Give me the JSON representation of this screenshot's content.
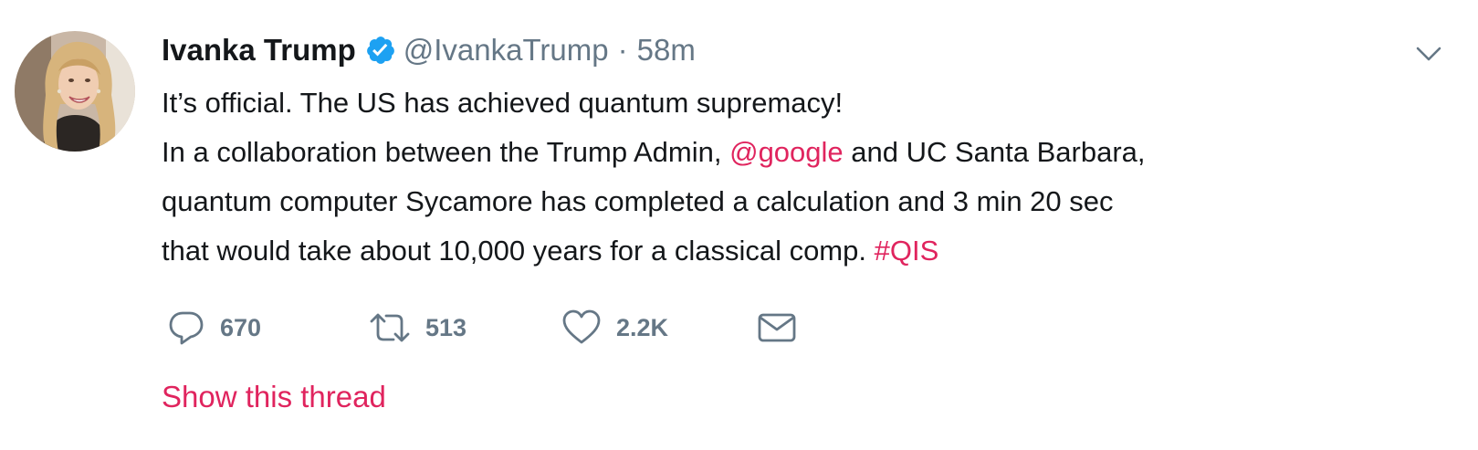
{
  "tweet": {
    "author": {
      "name": "Ivanka Trump",
      "handle": "@IvankaTrump",
      "separator": "·",
      "time": "58m",
      "verified_icon": "verified-badge-icon",
      "avatar": "profile-photo"
    },
    "text": {
      "line1": "It’s official. The US has achieved quantum supremacy!",
      "line2_pre": "In a collaboration between the Trump Admin, ",
      "line2_mention": "@google",
      "line2_post": " and UC Santa Barbara,",
      "line3": "quantum computer Sycamore  has completed a calculation and 3 min 20 sec",
      "line4_pre": "that would take about 10,000 years for a classical comp. ",
      "line4_hashtag": "#QIS"
    },
    "actions": {
      "reply_count": "670",
      "retweet_count": "513",
      "like_count": "2.2K",
      "reply_icon": "reply-icon",
      "retweet_icon": "retweet-icon",
      "like_icon": "heart-icon",
      "dm_icon": "envelope-icon"
    },
    "show_thread": "Show this thread",
    "menu_icon": "chevron-down-icon"
  },
  "colors": {
    "accent": "#e0245e",
    "verified": "#1da1f2",
    "muted": "#657786",
    "text": "#14171a"
  }
}
